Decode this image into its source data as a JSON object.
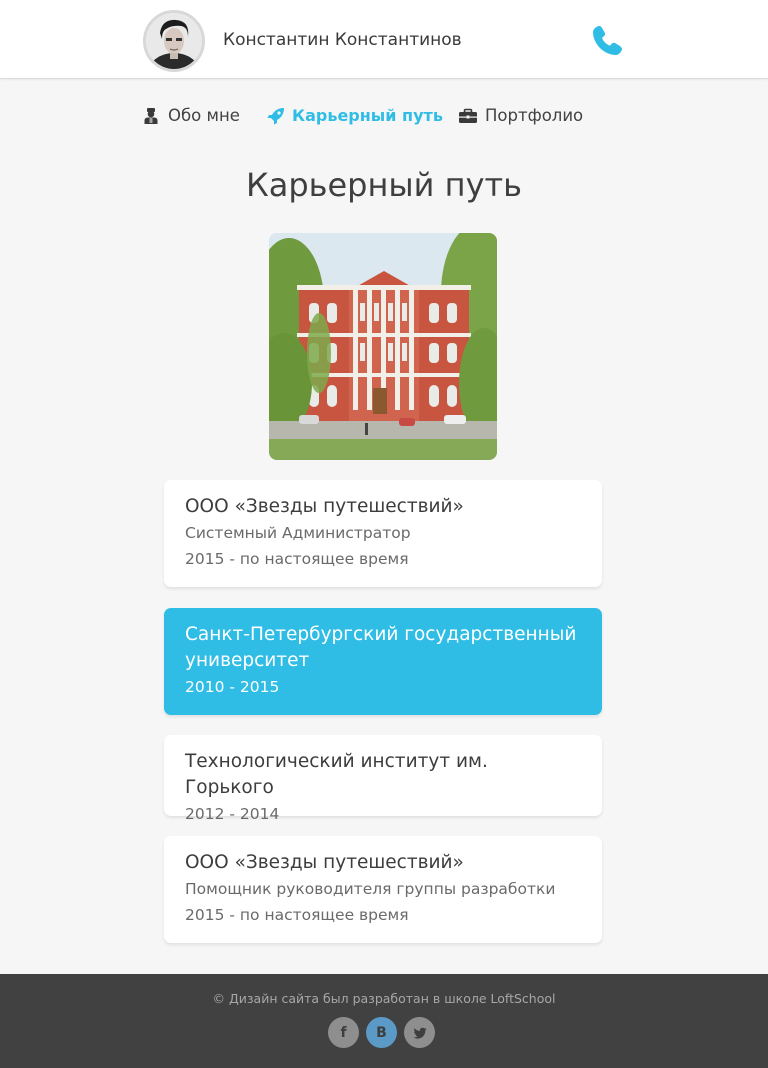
{
  "header": {
    "user_name": "Константин Константинов",
    "avatar_alt": "avatar",
    "phone_icon": "phone-icon"
  },
  "nav": {
    "items": [
      {
        "label": "Обо мне",
        "icon": "user-icon"
      },
      {
        "label": "Карьерный путь",
        "icon": "rocket-icon",
        "active": true
      },
      {
        "label": "Портфолио",
        "icon": "briefcase-icon"
      }
    ]
  },
  "page": {
    "title": "Карьерный путь"
  },
  "career": [
    {
      "org": "ООО «Звезды путешествий»",
      "role": "Системный Администратор",
      "dates": "2015 - по настоящее время"
    },
    {
      "org": "Санкт-Петербургский государственный университет",
      "dates": "2010 - 2015",
      "active": true
    },
    {
      "org": "Технологический институт им. Горького",
      "dates": "2012 - 2014"
    },
    {
      "org": "ООО «Звезды путешествий»",
      "role": "Помощник руководителя группы разработки",
      "dates": "2015 - по настоящее время"
    }
  ],
  "footer": {
    "copyright": "© Дизайн сайта был разработан в школе LoftSchool",
    "social": [
      {
        "name": "facebook-icon",
        "glyph": "f"
      },
      {
        "name": "vk-icon",
        "glyph": "B"
      },
      {
        "name": "twitter-icon",
        "glyph": "t"
      }
    ]
  },
  "colors": {
    "accent": "#2fbde6",
    "footer_bg": "#414141",
    "page_bg": "#f6f6f6"
  }
}
